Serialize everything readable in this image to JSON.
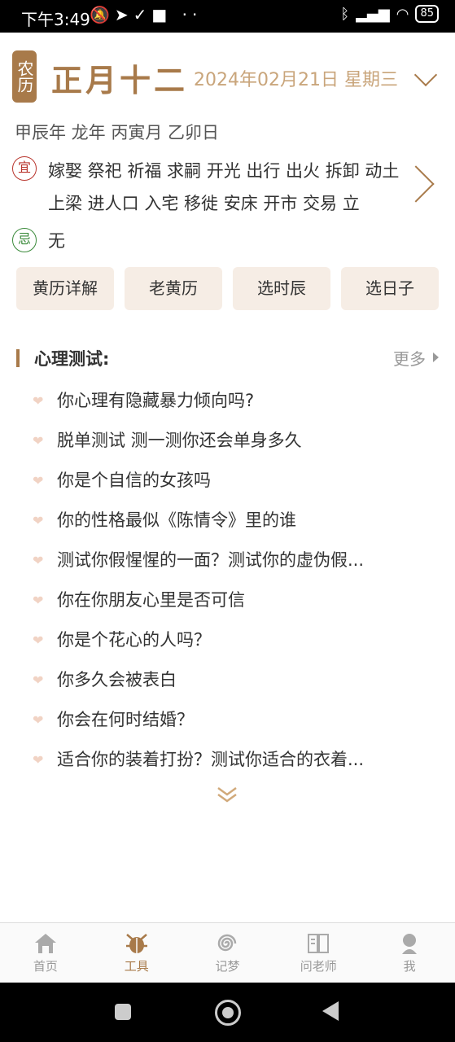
{
  "status_bar": {
    "time": "下午3:49",
    "battery": "85"
  },
  "header": {
    "badge": "农历",
    "lunar_date": "正月十二",
    "solar_date": "2024年02月21日 星期三"
  },
  "ganzhi": "甲辰年 龙年 丙寅月 乙卯日",
  "yi": {
    "icon_char": "宜",
    "text": "嫁娶 祭祀 祈福 求嗣 开光 出行 出火 拆卸 动土 上梁 进人口 入宅 移徙 安床 开市 交易 立"
  },
  "ji": {
    "icon_char": "忌",
    "text": "无"
  },
  "buttons": [
    "黄历详解",
    "老黄历",
    "选时辰",
    "选日子"
  ],
  "section": {
    "title": "心理测试:",
    "more_label": "更多"
  },
  "tests": [
    "你心理有隐藏暴力倾向吗?",
    "脱单测试 测一测你还会单身多久",
    "你是个自信的女孩吗",
    "你的性格最似《陈情令》里的谁",
    "测试你假惺惺的一面？测试你的虚伪假...",
    "你在你朋友心里是否可信",
    "你是个花心的人吗？",
    "你多久会被表白",
    "你会在何时结婚？",
    "适合你的装着打扮？测试你适合的衣着..."
  ],
  "tabbar": {
    "tabs": [
      {
        "label": "首页",
        "icon": "house-icon"
      },
      {
        "label": "工具",
        "icon": "bug-tool-icon",
        "active": true
      },
      {
        "label": "记梦",
        "icon": "spiral-icon"
      },
      {
        "label": "问老师",
        "icon": "book-icon"
      },
      {
        "label": "我",
        "icon": "person-icon"
      }
    ]
  },
  "colors": {
    "accent": "#a87a4a",
    "accent_light": "#c9a57b",
    "button_bg": "#f6ede5"
  }
}
